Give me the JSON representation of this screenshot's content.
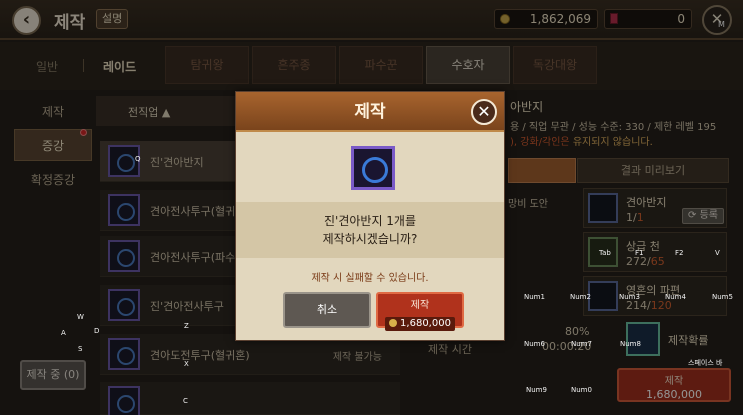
{
  "topbar": {
    "back_icon": "back-arrow-icon",
    "title": "제작",
    "help_label": "설명",
    "gold": "1,862,069",
    "gems": "0",
    "menu_key": "M"
  },
  "categories": {
    "general": "일반",
    "raid": "레이드",
    "tabs": [
      "탐귀왕",
      "흔주종",
      "파수꾼",
      "수호자",
      "독강대왕"
    ],
    "active_tab": "수호자"
  },
  "sidebar": {
    "items": [
      "제작",
      "증강",
      "확정증강"
    ],
    "active": "증강",
    "making_button": "제작 중 (0)"
  },
  "list": {
    "sort_label": "전직업 ▲",
    "rows": [
      {
        "name": "진'견아반지",
        "status": ""
      },
      {
        "name": "견아전사투구(혈귀",
        "status": ""
      },
      {
        "name": "견아전사투구(파수",
        "status": ""
      },
      {
        "name": "진'견아전사투구",
        "status": ""
      },
      {
        "name": "견아도전투구(혈귀혼)",
        "status": "제작 불가능"
      }
    ]
  },
  "info": {
    "name": "아반지",
    "line1": "용 / 직업 무관 / 성능 수준: 330 / 제한 레벨 195",
    "warn_prefix": "), 강화/각인은 ",
    "warn_keep": "유지되지 않습니다.",
    "preview_tab": "결과 미리보기",
    "material_left": "망비 도안",
    "results": [
      {
        "name": "견아반지",
        "qty": "1",
        "max": "1"
      },
      {
        "name": "상급 천",
        "qty": "272",
        "max": "65"
      },
      {
        "name": "영혼의 파편",
        "qty": "214",
        "max": "120"
      }
    ],
    "register_label": "등록",
    "craft_time_label": "제작 시간",
    "rate_percent": "80%",
    "rate_time": "00:00:20",
    "rate_label": "제작확률",
    "craft_button": "제작",
    "craft_price": "1,680,000"
  },
  "modal": {
    "title": "제작",
    "close_icon": "close-x-icon",
    "message_line1": "진'견아반지 1개를",
    "message_line2": "제작하시겠습니까?",
    "warning": "제작 시 실패할 수 있습니다.",
    "cancel": "취소",
    "confirm": "제작",
    "price": "1,680,000"
  },
  "key_hints": [
    "Q",
    "W",
    "A",
    "S",
    "D",
    "Z",
    "X",
    "C",
    "Tab",
    "F1",
    "F2",
    "V",
    "Num1",
    "Num2",
    "Num3",
    "Num4",
    "Num5",
    "Num6",
    "Num7",
    "Num8",
    "Num9",
    "Num0",
    "스페이스 바"
  ]
}
